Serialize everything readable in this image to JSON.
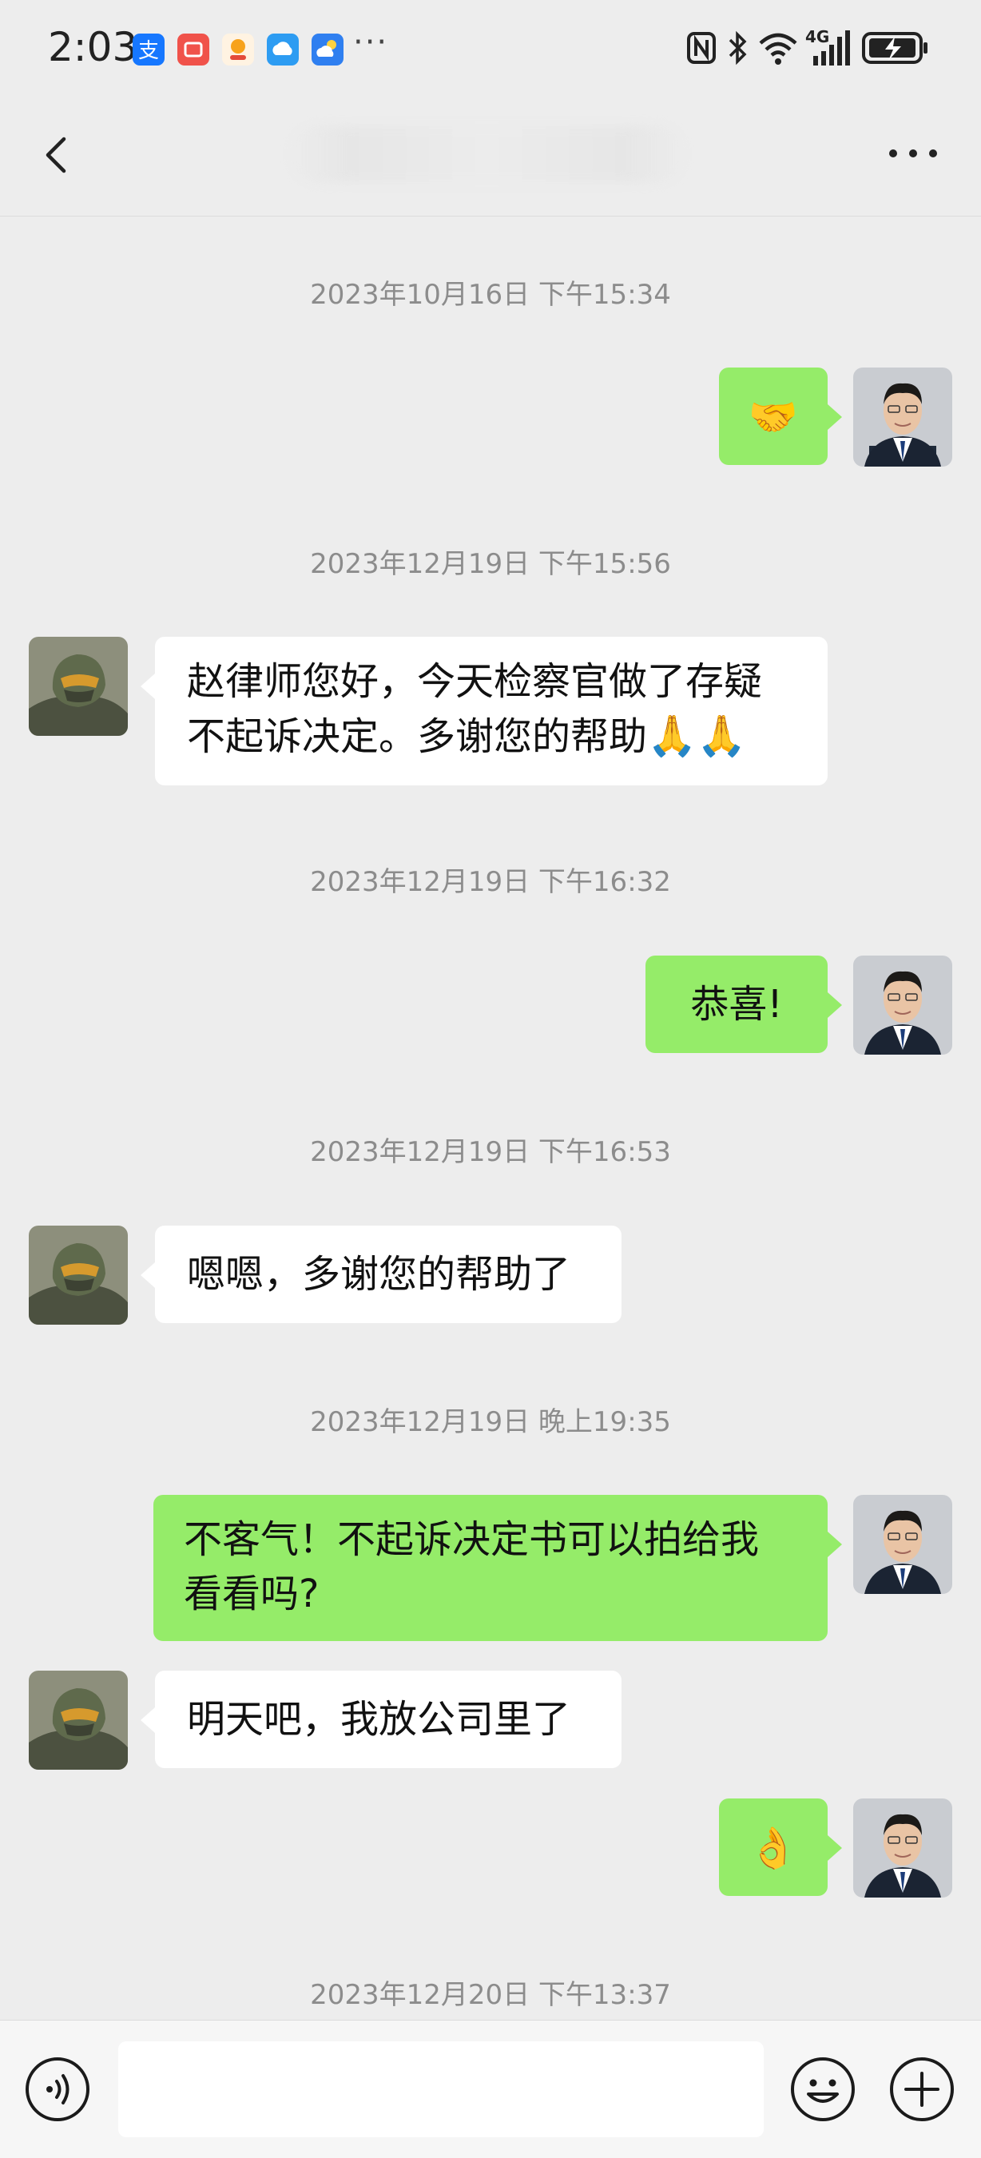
{
  "status_bar": {
    "time": "2:03",
    "more_indicator": "···",
    "network_label": "4G",
    "app_icons": [
      "alipay-icon",
      "shopping-app-icon",
      "food-app-icon",
      "cloud-app-icon",
      "weather-app-icon"
    ],
    "system_icons": [
      "nfc-icon",
      "bluetooth-icon",
      "wifi-icon",
      "signal-icon",
      "battery-charging-icon"
    ]
  },
  "nav": {
    "back_icon": "chevron-left-icon",
    "title": "",
    "more_icon": "more-dots-icon"
  },
  "colors": {
    "background": "#ededed",
    "sent_bubble": "#95ec69",
    "received_bubble": "#ffffff",
    "timestamp_text": "#8c8c8c"
  },
  "messages": {
    "ts1": "2023年10月16日 下午15:34",
    "m1": "🤝",
    "ts2": "2023年12月19日 下午15:56",
    "m2_line1": "赵律师您好，今天检察官做了存疑",
    "m2_line2": "不起诉决定。多谢您的帮助",
    "m2_emoji": "🙏🙏",
    "ts3": "2023年12月19日 下午16:32",
    "m3": "恭喜!",
    "ts4": "2023年12月19日 下午16:53",
    "m4": "嗯嗯，多谢您的帮助了",
    "ts5": "2023年12月19日 晚上19:35",
    "m5_line1": "不客气！不起诉决定书可以拍给我",
    "m5_line2": "看看吗?",
    "m6": "明天吧，我放公司里了",
    "m7": "👌",
    "ts6": "2023年12月20日 下午13:37"
  },
  "input_bar": {
    "voice_icon": "voice-icon",
    "input_value": "",
    "emoji_icon": "emoji-icon",
    "plus_icon": "plus-icon"
  }
}
